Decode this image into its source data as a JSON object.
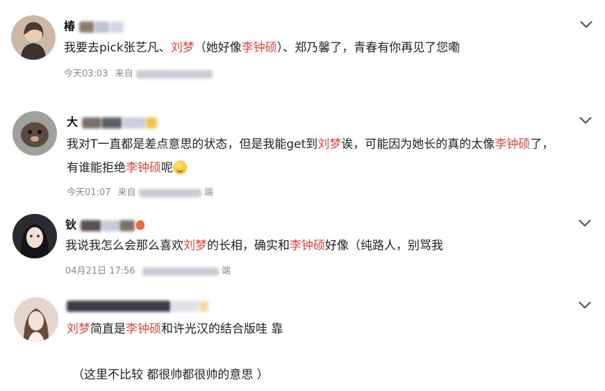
{
  "comments": [
    {
      "username_visible": "椿",
      "segments": [
        {
          "text": "我要去pick张艺凡、",
          "hl": false
        },
        {
          "text": "刘梦",
          "hl": true
        },
        {
          "text": "（她好像",
          "hl": false
        },
        {
          "text": "李钟硕",
          "hl": true
        },
        {
          "text": "）、郑乃馨了，青春有你再见了您嘞",
          "hl": false
        }
      ],
      "time": "今天03:03",
      "source_prefix": "来自"
    },
    {
      "username_visible": "大",
      "line1": [
        {
          "text": "我对T一直都是差点意思的状态，但是我能get到",
          "hl": false
        },
        {
          "text": "刘梦",
          "hl": true
        },
        {
          "text": "诶，可能因为她长的真的太像",
          "hl": false
        },
        {
          "text": "李钟硕",
          "hl": true
        },
        {
          "text": "了，",
          "hl": false
        }
      ],
      "line2": [
        {
          "text": "有谁能拒绝",
          "hl": false
        },
        {
          "text": "李钟硕",
          "hl": true
        },
        {
          "text": "呢",
          "hl": false
        }
      ],
      "time": "今天01:07",
      "source_prefix": "来自",
      "source_suffix": "端"
    },
    {
      "username_visible": "钬",
      "segments": [
        {
          "text": "我说我怎么会那么喜欢",
          "hl": false
        },
        {
          "text": "刘梦",
          "hl": true
        },
        {
          "text": "的长相，确实和",
          "hl": false
        },
        {
          "text": "李钟硕",
          "hl": true
        },
        {
          "text": "好像（纯路人，别骂我",
          "hl": false
        }
      ],
      "time": "04月21日 17:56",
      "source_suffix": "端"
    },
    {
      "username_visible": "",
      "segments": [
        {
          "text": "刘梦",
          "hl": true
        },
        {
          "text": "简直是",
          "hl": false
        },
        {
          "text": "李钟硕",
          "hl": true
        },
        {
          "text": "和许光汉的结合版哇 靠",
          "hl": false
        }
      ],
      "extra": "（这里不比较 都很帅都很帅的意思 ）"
    }
  ],
  "colors": {
    "highlight": "#e8453c",
    "meta": "#8a8a8a",
    "text": "#222222"
  },
  "icons": {
    "expand": "chevron-down-icon",
    "emoji": "smile-emoji-icon"
  }
}
